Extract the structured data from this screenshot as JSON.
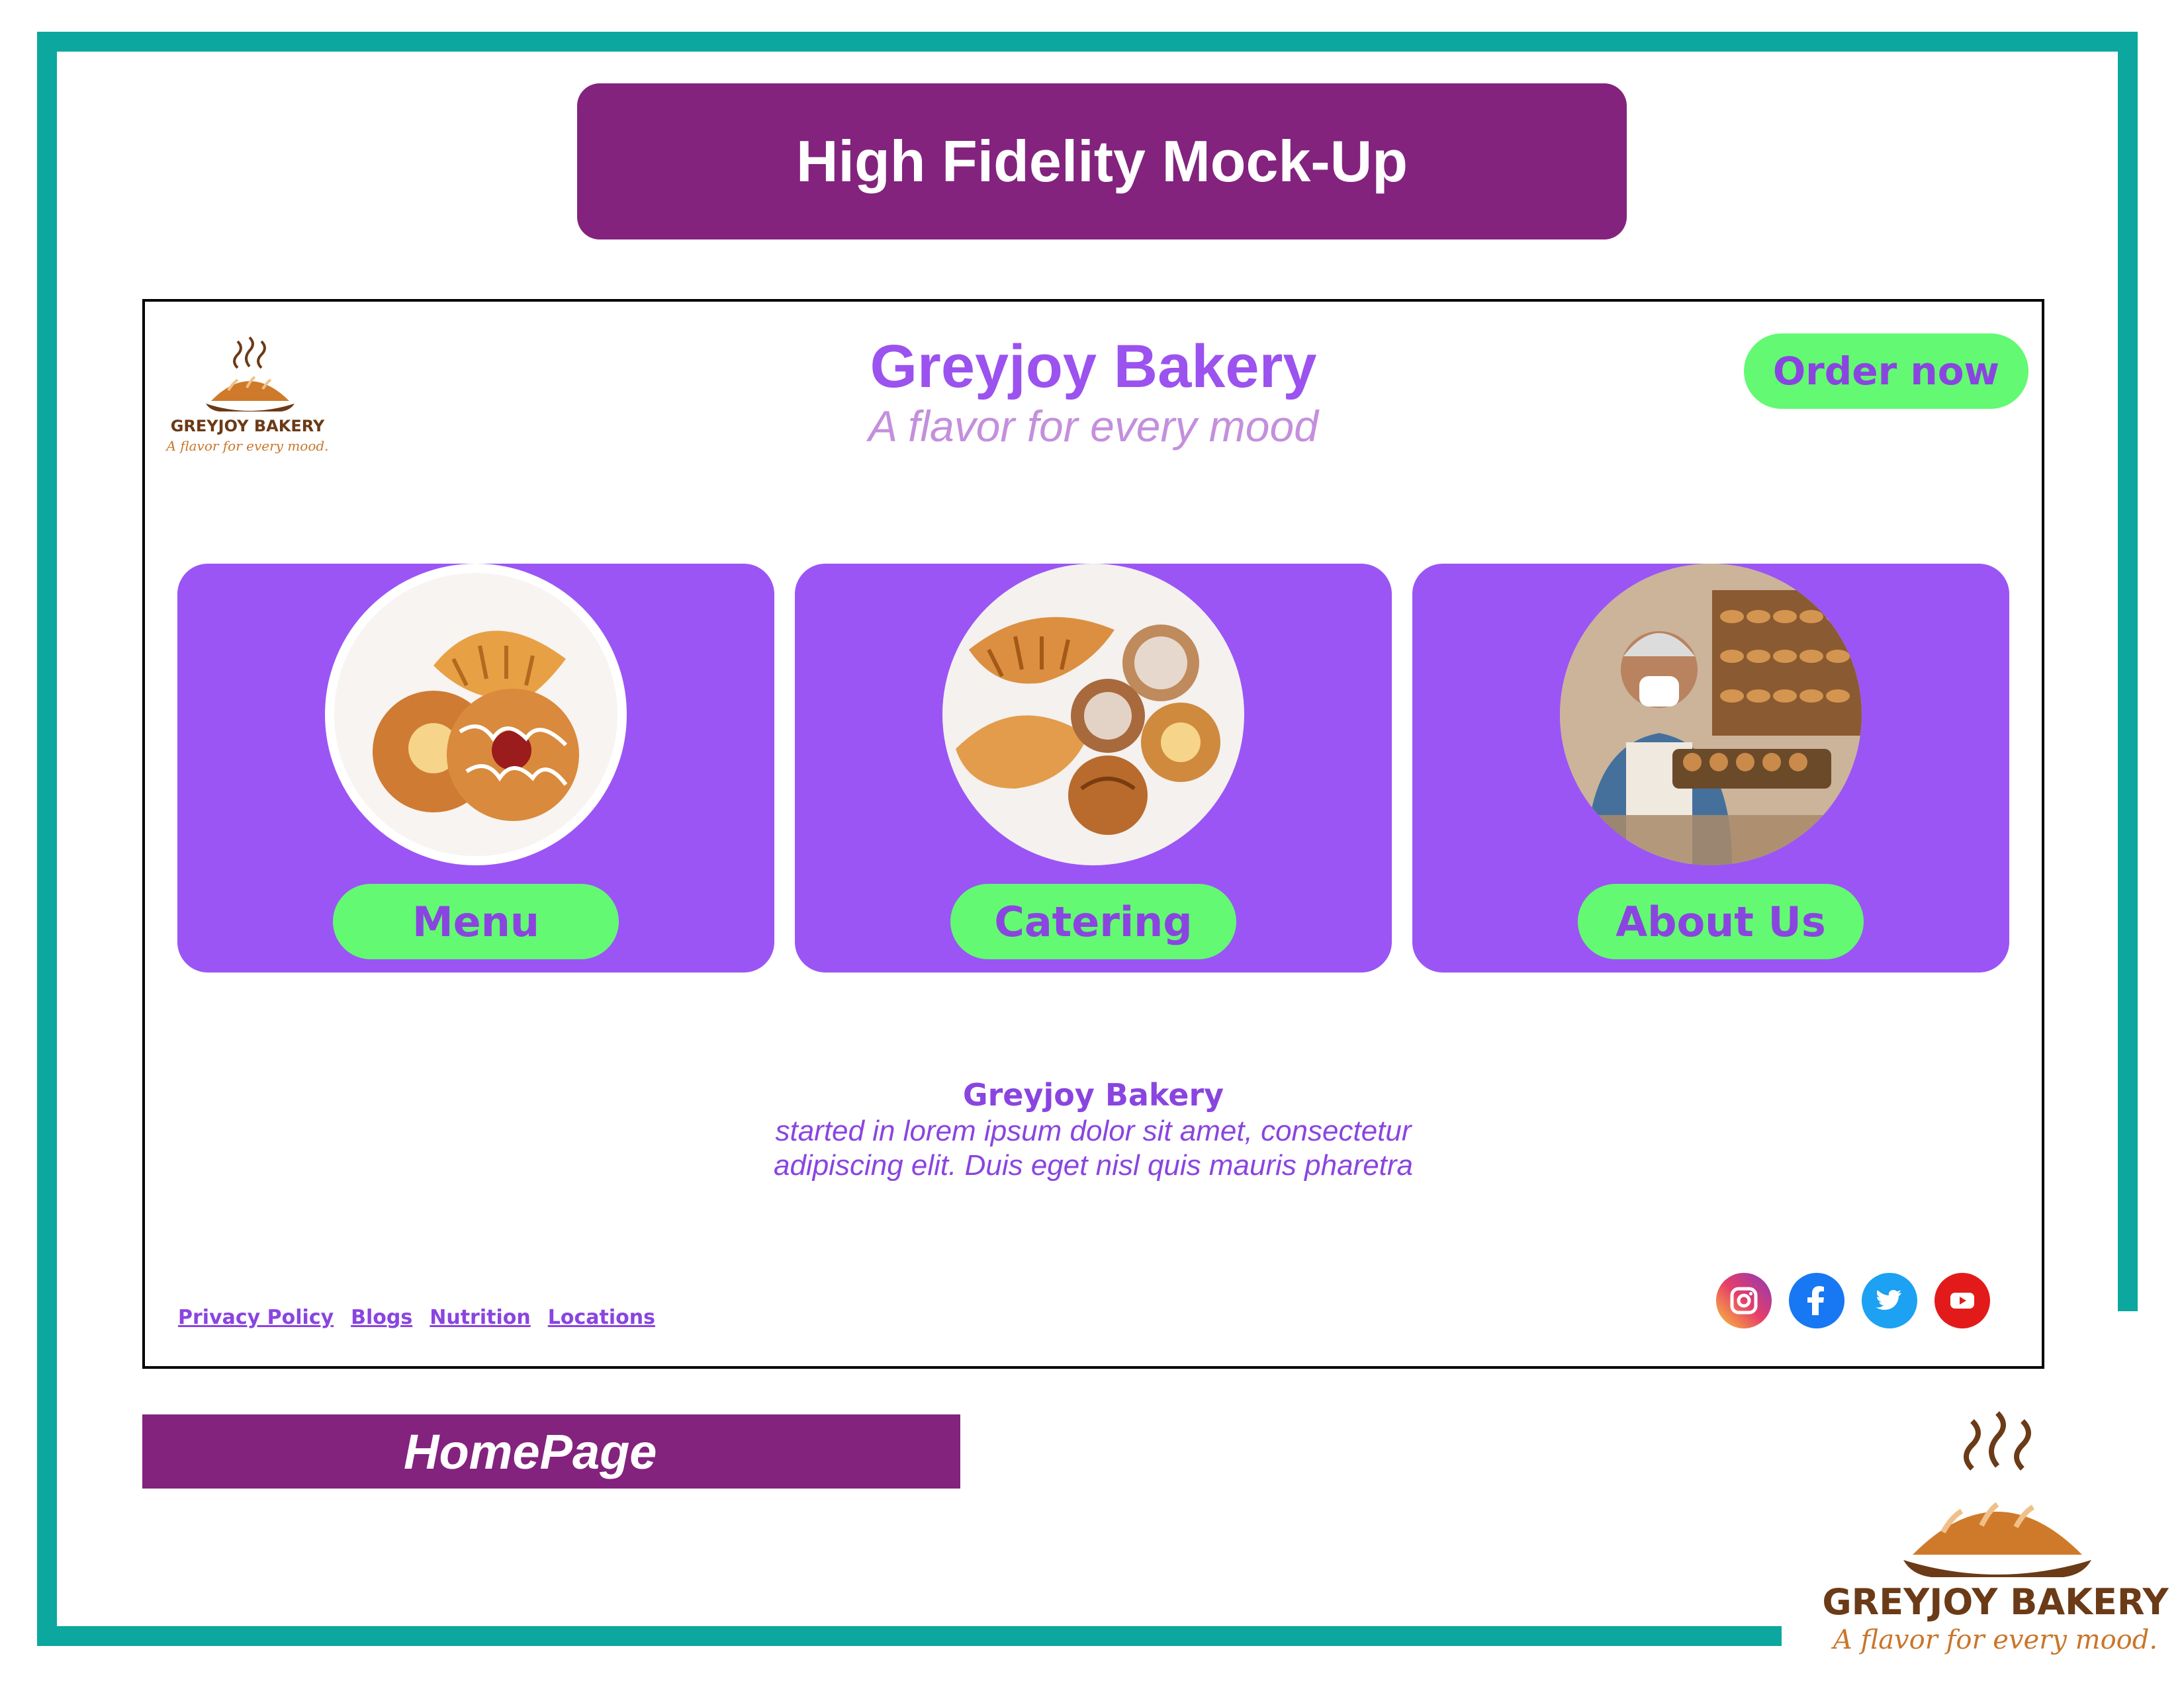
{
  "slide": {
    "title": "High Fidelity Mock-Up",
    "page_label": "HomePage"
  },
  "colors": {
    "teal_border": "#0ca79e",
    "banner_purple": "#83237e",
    "card_purple": "#9b55f4",
    "text_purple": "#8a45e0",
    "button_green": "#63f973",
    "tagline_pink": "#c48fdd"
  },
  "site": {
    "brand_name": "Greyjoy Bakery",
    "tagline": "A flavor for every mood",
    "order_button": "Order now",
    "logo": {
      "name": "GREYJOY BAKERY",
      "tagline": "A flavor for every mood."
    },
    "cards": [
      {
        "label": "Menu",
        "image": "pastries-photo"
      },
      {
        "label": "Catering",
        "image": "pastry-platter-photo"
      },
      {
        "label": "About Us",
        "image": "baker-photo"
      }
    ],
    "about": {
      "heading": "Greyjoy Bakery",
      "line1": "started in lorem ipsum dolor sit amet, consectetur",
      "line2": "adipiscing elit. Duis eget nisl quis mauris pharetra"
    },
    "footer_links": [
      "Privacy Policy",
      "Blogs",
      "Nutrition",
      "Locations"
    ],
    "social_icons": [
      "instagram-icon",
      "facebook-icon",
      "twitter-icon",
      "youtube-icon"
    ]
  },
  "corner_logo": {
    "name": "GREYJOY BAKERY",
    "tagline": "A flavor for every mood."
  }
}
